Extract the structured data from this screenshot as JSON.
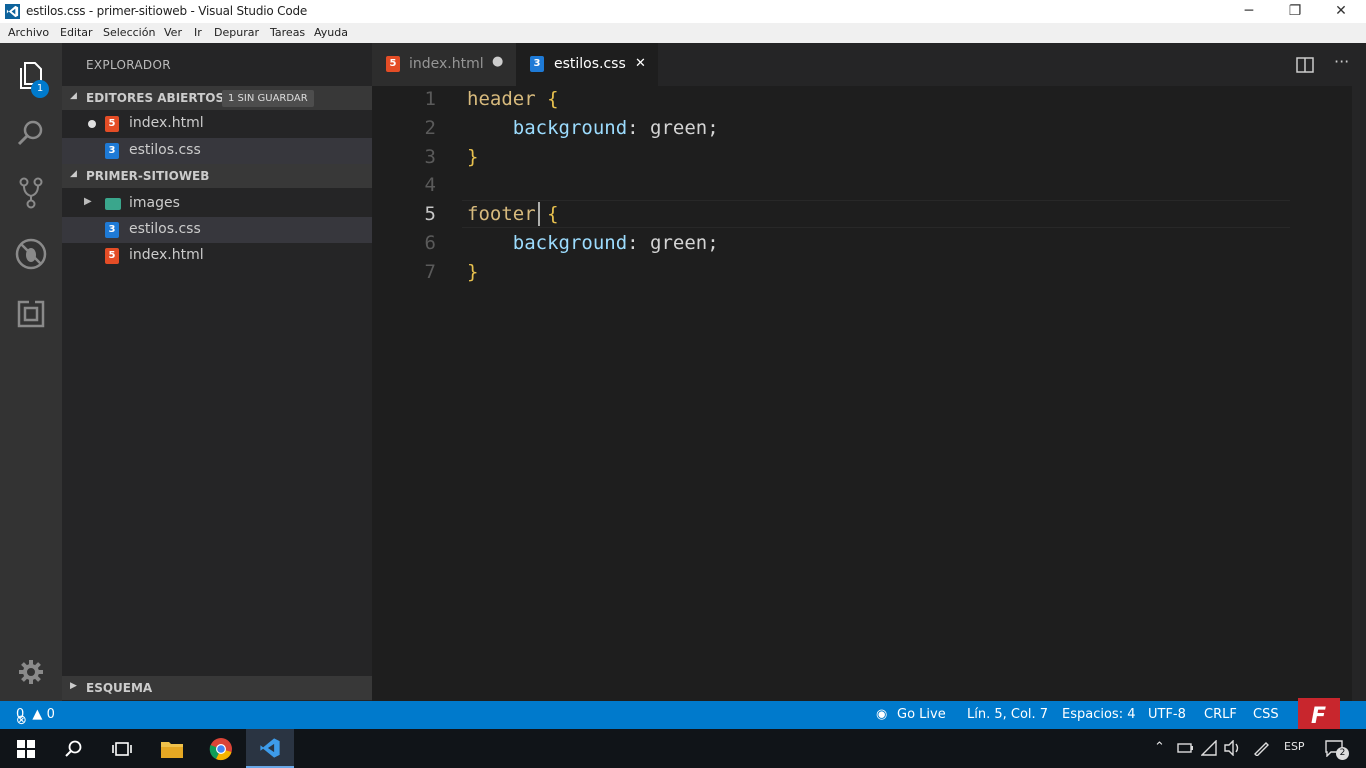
{
  "window": {
    "title": "estilos.css - primer-sitioweb - Visual Studio Code",
    "minimize": "─",
    "maximize": "❐",
    "close": "✕"
  },
  "menu": [
    "Archivo",
    "Editar",
    "Selección",
    "Ver",
    "Ir",
    "Depurar",
    "Tareas",
    "Ayuda"
  ],
  "activity": {
    "badge": "1",
    "items": [
      "explorer-icon",
      "search-icon",
      "source-control-icon",
      "debug-icon",
      "extensions-icon",
      "settings-gear-icon"
    ]
  },
  "sidebar": {
    "title": "EXPLORADOR",
    "open_editors": {
      "label": "EDITORES ABIERTOS",
      "pill": "1 SIN GUARDAR",
      "files": [
        {
          "name": "index.html",
          "icon": "5",
          "unsaved": true
        },
        {
          "name": "estilos.css",
          "icon": "3",
          "unsaved": false
        }
      ]
    },
    "project": {
      "label": "PRIMER-SITIOWEB",
      "folder": "images",
      "files": [
        {
          "name": "estilos.css",
          "icon": "3"
        },
        {
          "name": "index.html",
          "icon": "5"
        }
      ]
    },
    "outline": "ESQUEMA"
  },
  "tabs": [
    {
      "label": "index.html",
      "icon": "5",
      "marker": "●"
    },
    {
      "label": "estilos.css",
      "icon": "3",
      "marker": "✕"
    }
  ],
  "editor": {
    "lines": [
      {
        "n": "1",
        "sel": "header",
        "rest": " {"
      },
      {
        "n": "2",
        "prop": "    background",
        "rest": ": green;"
      },
      {
        "n": "3",
        "brace": "}"
      },
      {
        "n": "4"
      },
      {
        "n": "5",
        "sel": "footer",
        "rest": " {"
      },
      {
        "n": "6",
        "prop": "    background",
        "rest": ": green;"
      },
      {
        "n": "7",
        "brace": "}"
      }
    ]
  },
  "status": {
    "errors": "0",
    "warnings": "0",
    "go_live": "Go Live",
    "position": "Lín. 5, Col. 7",
    "spaces": "Espacios: 4",
    "encoding": "UTF-8",
    "eol": "CRLF",
    "language": "CSS"
  },
  "taskbar": {
    "tray_lang": "ESP",
    "notif_count": "2",
    "watermark": "F"
  },
  "colors": {
    "accent": "#007acc",
    "selector": "#d7ba7d",
    "property": "#9cdcfe",
    "html_icon": "#e44d26",
    "css_icon": "#1e7ad6"
  }
}
